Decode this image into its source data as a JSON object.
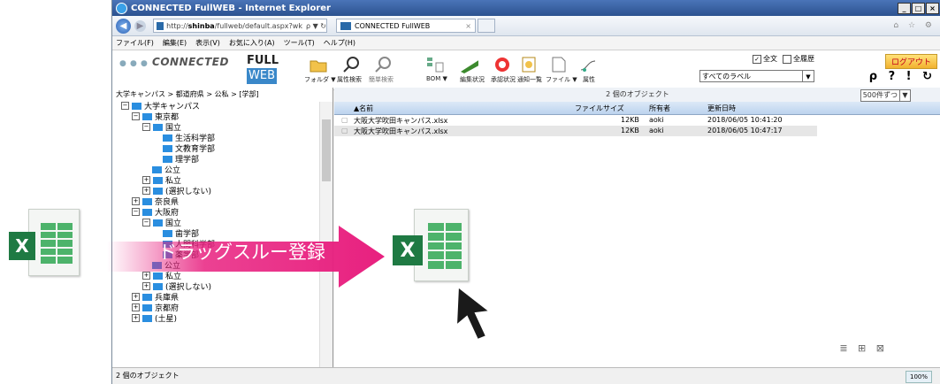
{
  "window": {
    "title": "CONNECTED FullWEB - Internet Explorer"
  },
  "browser": {
    "url_prefix": "http://",
    "url_host": "shinba",
    "url_path": "/fullweb/default.aspx?wk",
    "url_controls": "ρ ▼ ↻",
    "tab_title": "CONNECTED FullWEB",
    "tab_close": "×",
    "tool_icons": "⌂ ☆ ⚙"
  },
  "menu": [
    "ファイル(F)",
    "編集(E)",
    "表示(V)",
    "お気に入り(A)",
    "ツール(T)",
    "ヘルプ(H)"
  ],
  "toolbar": {
    "logo": "CONNECTED",
    "full": "FULL",
    "web": "WEB",
    "items": [
      "フォルダ ▼",
      "属性検索",
      "簡単検索",
      "BOM ▼",
      "編集状況",
      "承認状況",
      "通知一覧",
      "ファイル ▼",
      "属性"
    ],
    "chk_fulltext_label": "全文",
    "chk_fulltext_mark": "✓",
    "chk_all_label": "全履歴",
    "logout": "ログアウト",
    "label_select": "すべてのラベル",
    "right_icons": "ρ ? ! ↻",
    "dropdown_mark": "▼"
  },
  "tree": {
    "breadcrumb": "大学キャンパス > 都道府県 > 公私 > [学部]",
    "nodes": [
      {
        "t": "大学キャンパス",
        "pm": "−"
      },
      {
        "t": "東京都",
        "pm": "−"
      },
      {
        "t": "国立",
        "pm": "−"
      },
      {
        "t": "生活科学部",
        "pm": ""
      },
      {
        "t": "文教育学部",
        "pm": ""
      },
      {
        "t": "理学部",
        "pm": ""
      },
      {
        "t": "公立",
        "pm": ""
      },
      {
        "t": "私立",
        "pm": "+"
      },
      {
        "t": "(選択しない)",
        "pm": "+"
      },
      {
        "t": "奈良県",
        "pm": "+"
      },
      {
        "t": "大阪府",
        "pm": "−"
      },
      {
        "t": "国立",
        "pm": "−"
      },
      {
        "t": "歯学部",
        "pm": ""
      },
      {
        "t": "人間科学部",
        "pm": ""
      },
      {
        "t": "薬学部",
        "pm": ""
      },
      {
        "t": "公立",
        "pm": ""
      },
      {
        "t": "私立",
        "pm": "+"
      },
      {
        "t": "(選択しない)",
        "pm": "+"
      },
      {
        "t": "兵庫県",
        "pm": "+"
      },
      {
        "t": "京都府",
        "pm": "+"
      },
      {
        "t": "(土星)",
        "pm": "+"
      }
    ]
  },
  "list": {
    "count_label": "2 個のオブジェクト",
    "per_page": "500件ずつ",
    "columns": [
      "▲名前",
      "ファイルサイズ",
      "所有者",
      "更新日時"
    ],
    "rows": [
      {
        "name": "大阪大学吹田キャンパス.xlsx",
        "size": "12KB",
        "owner": "aoki",
        "date": "2018/06/05 10:41:20"
      },
      {
        "name": "大阪大学吹田キャンパス.xlsx",
        "size": "12KB",
        "owner": "aoki",
        "date": "2018/06/05 10:47:17"
      }
    ],
    "view_icons": "≣ ⊞ ⊠"
  },
  "status": {
    "text": "2 個のオブジェクト",
    "zoom": "100%"
  },
  "overlay": {
    "banner_text": "ドラッグスルー登録",
    "excel_letter": "X"
  },
  "colors": {
    "accent": "#e8207f",
    "excel": "#1f7a43",
    "folder": "#2a8ee0"
  }
}
